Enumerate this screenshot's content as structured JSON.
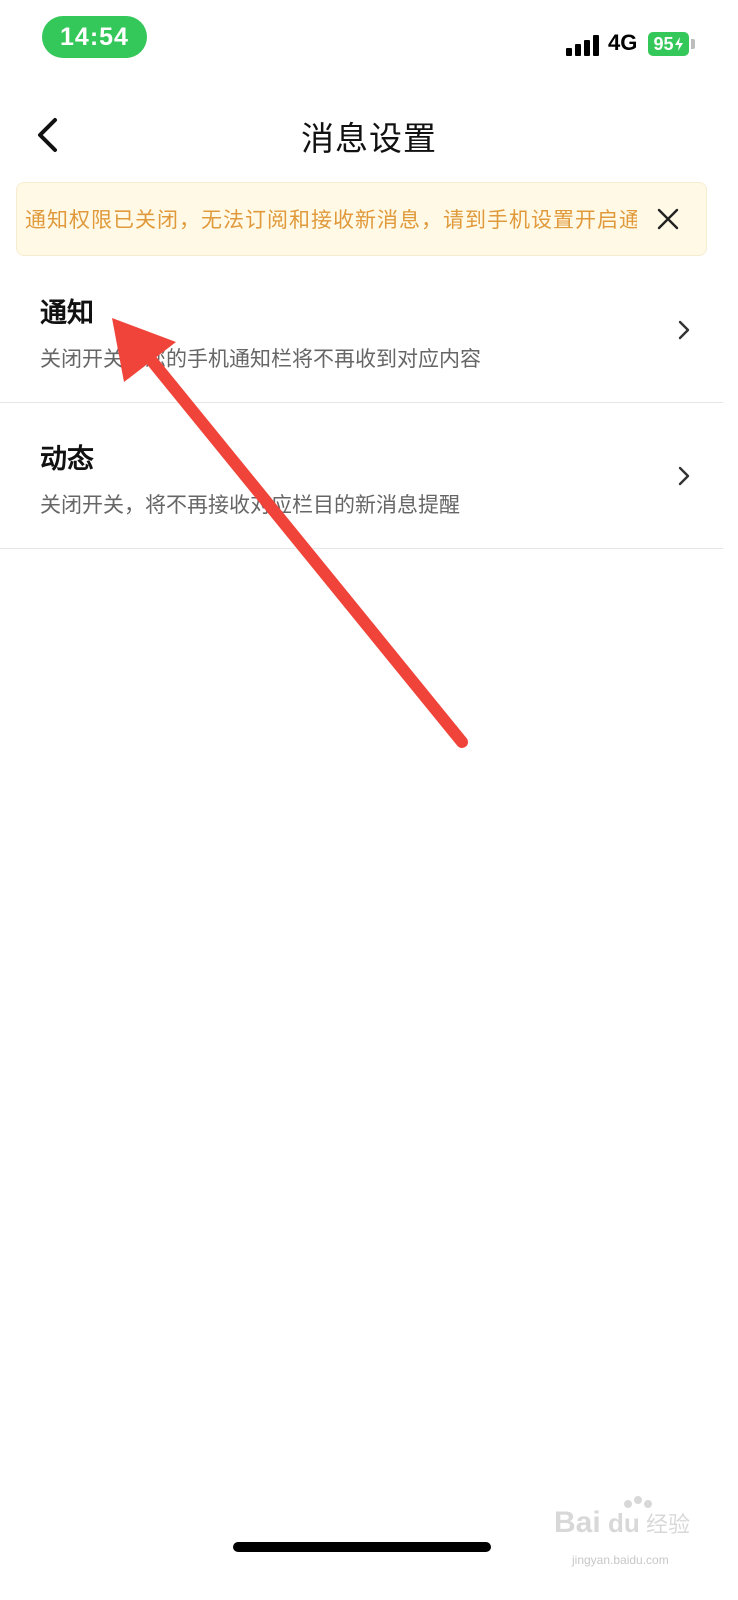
{
  "status_bar": {
    "time": "14:54",
    "network": "4G",
    "battery": "95",
    "colors": {
      "time_pill": "#34c759",
      "battery": "#34c759"
    }
  },
  "header": {
    "back_icon": "chevron-left-icon",
    "title": "消息设置"
  },
  "notice": {
    "text": "通知权限已关闭，无法订阅和接收新消息，请到手机设置开启通知权限",
    "close_icon": "close-icon",
    "colors": {
      "text": "#e09a3b",
      "background": "#fff9e6"
    }
  },
  "settings": {
    "items": [
      {
        "title": "通知",
        "description": "关闭开关，您的手机通知栏将不再收到对应内容",
        "chevron": "chevron-right-icon"
      },
      {
        "title": "动态",
        "description": "关闭开关，将不再接收对应栏目的新消息提醒",
        "chevron": "chevron-right-icon"
      }
    ]
  },
  "annotation": {
    "arrow_color": "#f0443a"
  },
  "watermark": {
    "label": "Bai du 经验",
    "sub": "jingyan.baidu.com"
  }
}
